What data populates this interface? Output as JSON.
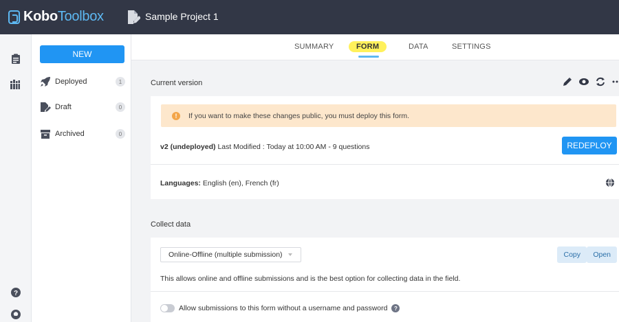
{
  "app": {
    "logo_kobo": "Kobo",
    "logo_toolbox": "Toolbox",
    "project_title": "Sample Project 1"
  },
  "sidebar": {
    "new_label": "NEW",
    "items": [
      {
        "label": "Deployed",
        "count": "1"
      },
      {
        "label": "Draft",
        "count": "0"
      },
      {
        "label": "Archived",
        "count": "0"
      }
    ]
  },
  "tabs": [
    {
      "label": "SUMMARY"
    },
    {
      "label": "FORM",
      "active": true
    },
    {
      "label": "DATA"
    },
    {
      "label": "SETTINGS"
    }
  ],
  "current_version": {
    "label": "Current version",
    "warning": "If you want to make these changes public, you must deploy this form.",
    "version": "v2 (undeployed)",
    "modified": "Last Modified : Today at 10:00 AM - 9 questions",
    "redeploy_label": "REDEPLOY",
    "languages_label": "Languages:",
    "languages_value": "English (en), French (fr)"
  },
  "collect": {
    "label": "Collect data",
    "selected_option": "Online-Offline (multiple submission)",
    "copy_label": "Copy",
    "open_label": "Open",
    "description": "This allows online and offline submissions and is the best option for collecting data in the field.",
    "toggle_label": "Allow submissions to this form without a username and password"
  },
  "colors": {
    "topbar": "#323746",
    "accent": "#2095f3",
    "warning_bg": "#fde7cc",
    "active_tab": "#fff15c"
  },
  "icons": {
    "rail": [
      "clipboard-icon",
      "library-icon",
      "help-icon",
      "github-icon"
    ],
    "actions": [
      "edit-icon",
      "preview-icon",
      "replace-icon",
      "more-icon"
    ]
  }
}
